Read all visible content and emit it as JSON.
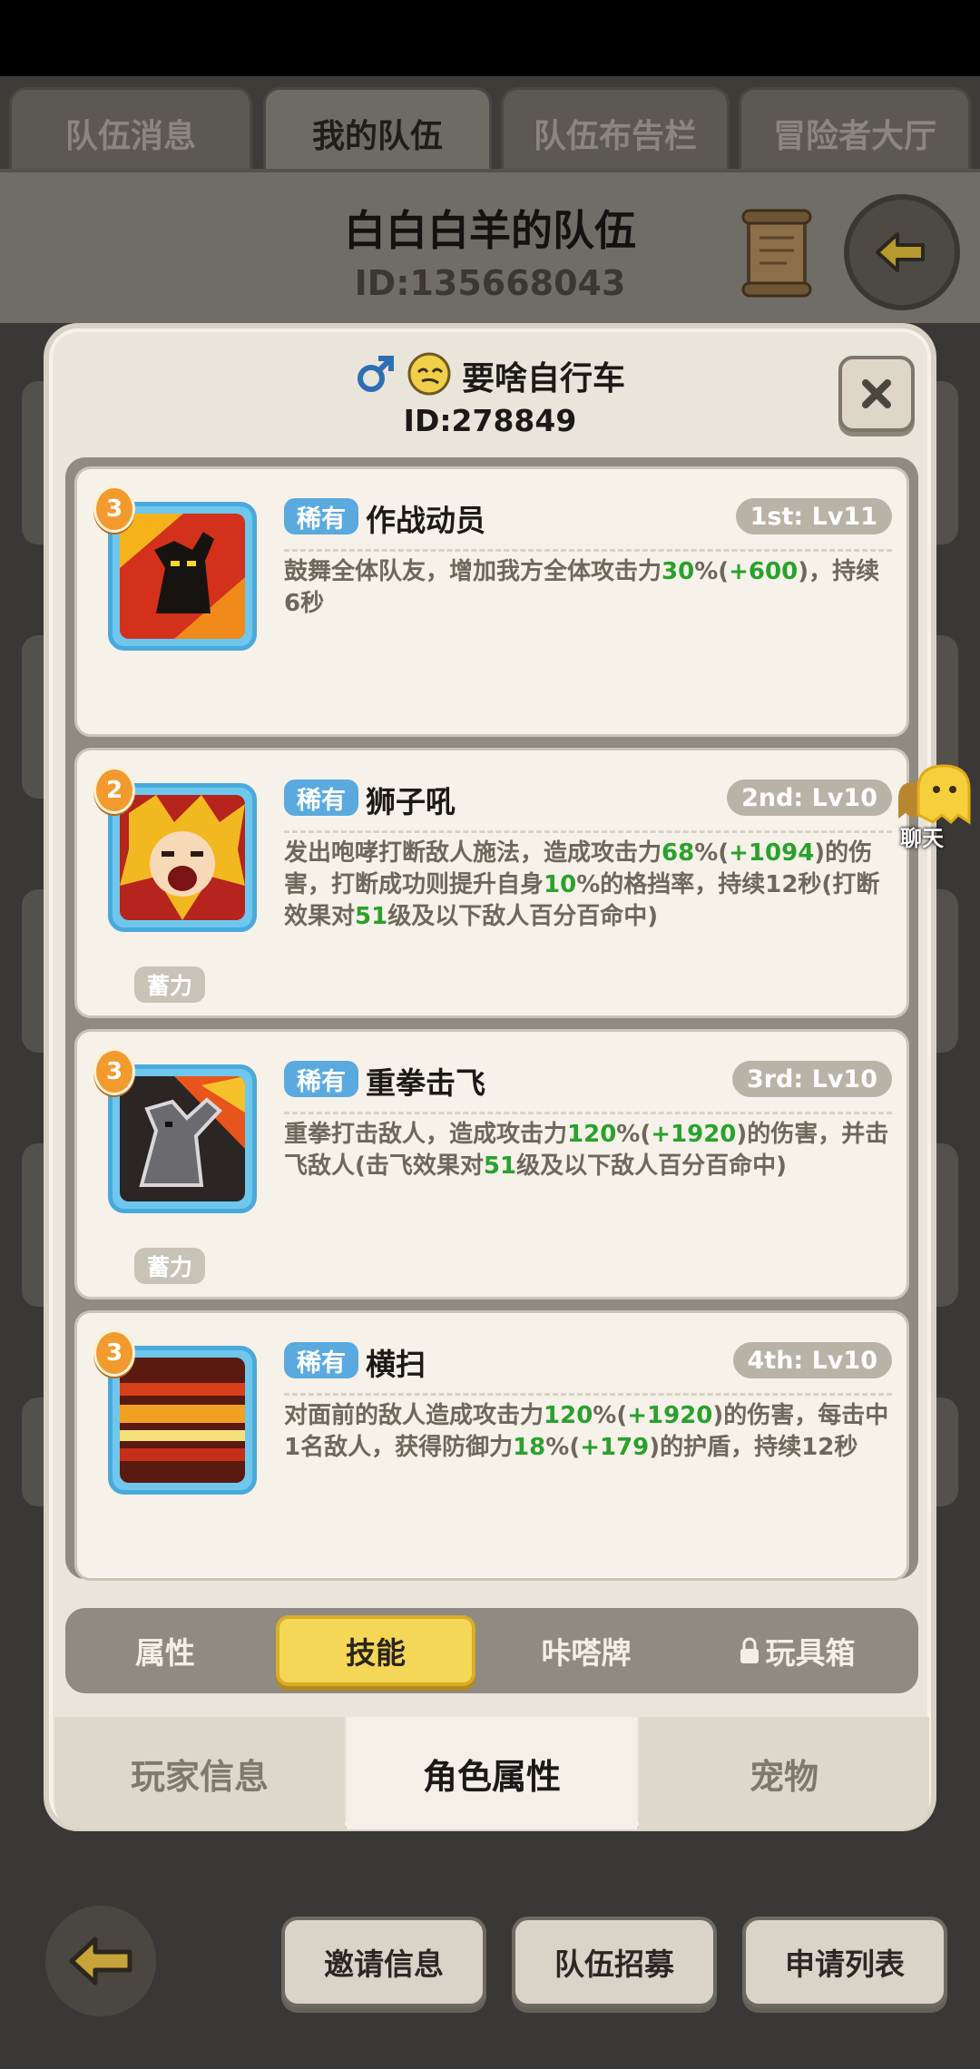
{
  "top_tabs": [
    {
      "label": "队伍消息",
      "active": false
    },
    {
      "label": "我的队伍",
      "active": true
    },
    {
      "label": "队伍布告栏",
      "active": false
    },
    {
      "label": "冒险者大厅",
      "active": false
    }
  ],
  "team": {
    "name": "白白白羊的队伍",
    "id": "ID:135668043"
  },
  "profile": {
    "gender_icon": "male-symbol-icon",
    "name": "要啥自行车",
    "id": "ID:278849"
  },
  "skills": [
    {
      "level": "3",
      "rarity": "稀有",
      "name": "作战动员",
      "slot": "1st: Lv11",
      "desc": [
        {
          "t": "鼓舞全体队友，增加我方全体攻击力"
        },
        {
          "t": "30",
          "g": true
        },
        {
          "t": "%("
        },
        {
          "t": "+600",
          "g": true
        },
        {
          "t": ")，持续6秒"
        }
      ],
      "tag": ""
    },
    {
      "level": "2",
      "rarity": "稀有",
      "name": "狮子吼",
      "slot": "2nd: Lv10",
      "desc": [
        {
          "t": "发出咆哮打断敌人施法，造成攻击力"
        },
        {
          "t": "68",
          "g": true
        },
        {
          "t": "%("
        },
        {
          "t": "+1094",
          "g": true
        },
        {
          "t": ")的伤害，打断成功则提升自身"
        },
        {
          "t": "10",
          "g": true
        },
        {
          "t": "%的格挡率，持续12秒(打断效果对"
        },
        {
          "t": "51",
          "g": true
        },
        {
          "t": "级及以下敌人百分百命中)"
        }
      ],
      "tag": "蓄力"
    },
    {
      "level": "3",
      "rarity": "稀有",
      "name": "重拳击飞",
      "slot": "3rd: Lv10",
      "desc": [
        {
          "t": "重拳打击敌人，造成攻击力"
        },
        {
          "t": "120",
          "g": true
        },
        {
          "t": "%("
        },
        {
          "t": "+1920",
          "g": true
        },
        {
          "t": ")的伤害，并击飞敌人(击飞效果对"
        },
        {
          "t": "51",
          "g": true
        },
        {
          "t": "级及以下敌人百分百命中)"
        }
      ],
      "tag": "蓄力"
    },
    {
      "level": "3",
      "rarity": "稀有",
      "name": "横扫",
      "slot": "4th: Lv10",
      "desc": [
        {
          "t": "对面前的敌人造成攻击力"
        },
        {
          "t": "120",
          "g": true
        },
        {
          "t": "%("
        },
        {
          "t": "+1920",
          "g": true
        },
        {
          "t": ")的伤害，每击中1名敌人，获得防御力"
        },
        {
          "t": "18",
          "g": true
        },
        {
          "t": "%("
        },
        {
          "t": "+179",
          "g": true
        },
        {
          "t": ")的护盾，持续12秒"
        }
      ],
      "tag": ""
    }
  ],
  "chat": {
    "label": "聊天"
  },
  "sub_tabs": [
    {
      "label": "属性",
      "active": false,
      "locked": false
    },
    {
      "label": "技能",
      "active": true,
      "locked": false
    },
    {
      "label": "咔嗒牌",
      "active": false,
      "locked": false
    },
    {
      "label": "玩具箱",
      "active": false,
      "locked": true
    }
  ],
  "bottom_tabs": [
    {
      "label": "玩家信息",
      "active": false
    },
    {
      "label": "角色属性",
      "active": true
    },
    {
      "label": "宠物",
      "active": false
    }
  ],
  "footer": {
    "invite": "邀请信息",
    "recruit": "队伍招募",
    "apply": "申请列表"
  },
  "colors": {
    "highlight_green": "#2aa12c",
    "rare_blue": "#5aaae0",
    "active_tab_yellow": "#f5d757"
  }
}
